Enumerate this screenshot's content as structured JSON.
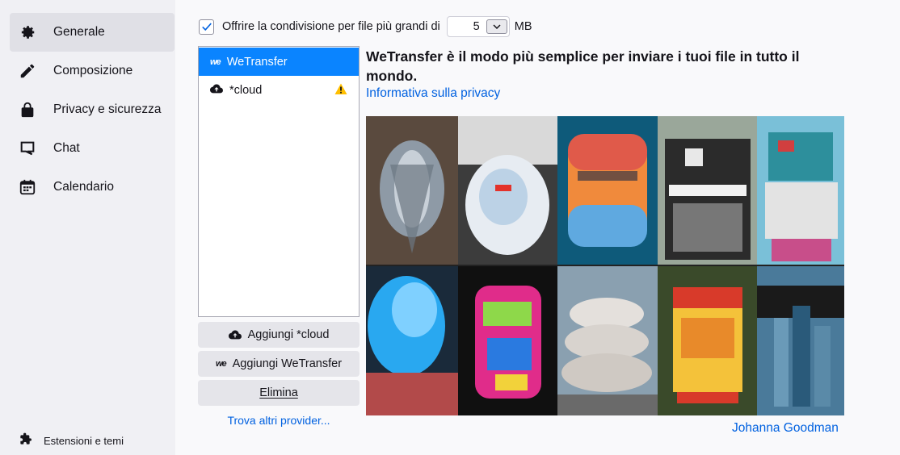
{
  "sidebar": {
    "items": [
      {
        "label": "Generale",
        "icon": "gear-icon"
      },
      {
        "label": "Composizione",
        "icon": "pencil-icon"
      },
      {
        "label": "Privacy e sicurezza",
        "icon": "lock-icon"
      },
      {
        "label": "Chat",
        "icon": "chat-bubble-icon"
      },
      {
        "label": "Calendario",
        "icon": "calendar-icon"
      }
    ],
    "extensions_label": "Estensioni e temi"
  },
  "share": {
    "checkbox_label": "Offrire la condivisione per file più grandi di",
    "checked": true,
    "size_value": "5",
    "unit": "MB"
  },
  "providers": [
    {
      "name": "WeTransfer",
      "icon": "wetransfer-icon",
      "selected": true
    },
    {
      "name": "*cloud",
      "icon": "cloud-upload-icon",
      "warning": true
    }
  ],
  "buttons": {
    "add_cloud": "Aggiungi *cloud",
    "add_wetransfer": "Aggiungi WeTransfer",
    "delete": "Elimina",
    "find_more": "Trova altri provider..."
  },
  "detail": {
    "description": "WeTransfer è il modo più semplice per inviare i tuoi file in tutto il mondo.",
    "privacy_link": "Informativa sulla privacy",
    "image_credit": "Johanna Goodman"
  },
  "colors": {
    "accent": "#0a84ff",
    "link": "#0061e0",
    "warning": "#ffbf00"
  }
}
